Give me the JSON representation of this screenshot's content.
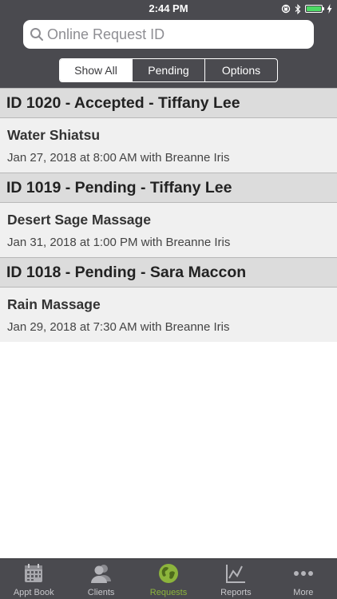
{
  "status_bar": {
    "time": "2:44 PM"
  },
  "search": {
    "placeholder": "Online Request ID",
    "value": ""
  },
  "filter": {
    "segments": [
      {
        "label": "Show All",
        "selected": true
      },
      {
        "label": "Pending",
        "selected": false
      },
      {
        "label": "Options",
        "selected": false
      }
    ]
  },
  "requests": [
    {
      "header": "ID 1020 - Accepted - Tiffany Lee",
      "service": "Water Shiatsu",
      "details": "Jan 27, 2018 at 8:00 AM with Breanne Iris"
    },
    {
      "header": "ID 1019 - Pending - Tiffany Lee",
      "service": "Desert Sage Massage",
      "details": "Jan 31, 2018 at 1:00 PM with Breanne Iris"
    },
    {
      "header": "ID 1018 - Pending - Sara Maccon",
      "service": "Rain Massage",
      "details": "Jan 29, 2018 at 7:30 AM with Breanne Iris"
    }
  ],
  "tab_bar": {
    "items": [
      {
        "label": "Appt Book",
        "icon": "calendar-icon",
        "active": false
      },
      {
        "label": "Clients",
        "icon": "clients-icon",
        "active": false
      },
      {
        "label": "Requests",
        "icon": "globe-icon",
        "active": true
      },
      {
        "label": "Reports",
        "icon": "chart-icon",
        "active": false
      },
      {
        "label": "More",
        "icon": "more-icon",
        "active": false
      }
    ]
  },
  "colors": {
    "chrome": "#4a4a4f",
    "accent": "#8cb43c",
    "section_header_bg": "#dcdcdc",
    "row_bg": "#f0f0f0"
  }
}
